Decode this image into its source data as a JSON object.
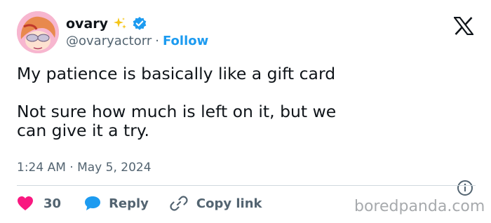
{
  "author": {
    "display_name": "ovary",
    "handle": "@ovaryactorr",
    "follow_label": "Follow",
    "separator": "·",
    "badges": [
      "sparkles-icon",
      "verified-icon"
    ]
  },
  "platform_logo": "x-logo-icon",
  "tweet": {
    "lines": [
      "My patience is basically like a gift card",
      "",
      "Not sure how much is left on it, but we",
      "can give it a try."
    ]
  },
  "timestamp": "1:24 AM · May 5, 2024",
  "actions": {
    "like_count": "30",
    "reply_label": "Reply",
    "copy_link_label": "Copy link"
  },
  "watermark": "boredpanda.com",
  "colors": {
    "link_blue": "#1d9bf0",
    "like_pink": "#f91880",
    "secondary_text": "#536471",
    "primary_text": "#0f1419",
    "divider": "#cfd9de"
  }
}
